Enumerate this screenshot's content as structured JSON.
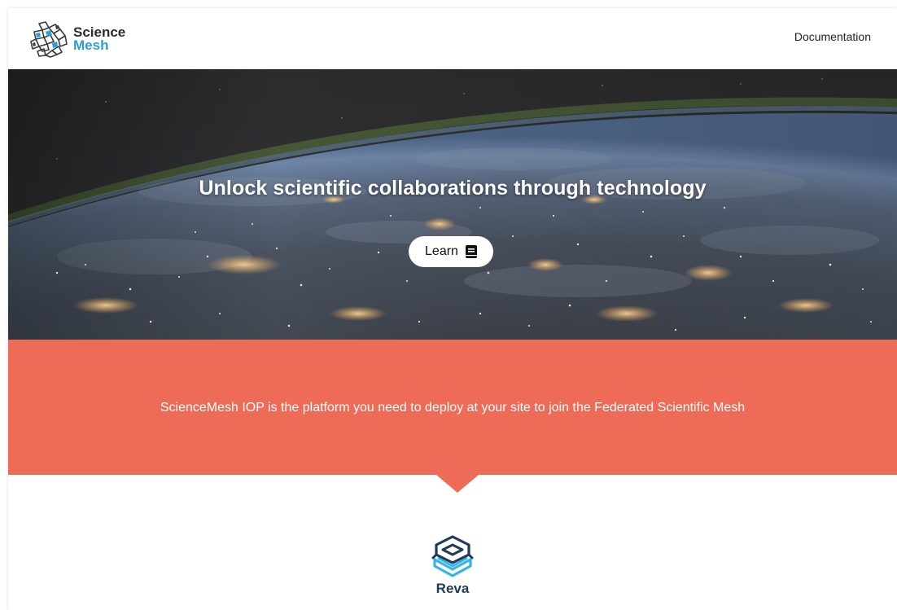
{
  "header": {
    "brand_word1": "Science",
    "brand_word2": "Mesh",
    "nav": [
      {
        "label": "Documentation"
      }
    ]
  },
  "hero": {
    "title": "Unlock scientific collaborations through technology",
    "button_label": "Learn",
    "button_icon": "book-icon"
  },
  "band": {
    "text": "ScienceMesh IOP is the platform you need to deploy at your site to join the Federated Scientific Mesh",
    "color": "#ee6b58"
  },
  "reva": {
    "label": "Reva",
    "icon": "reva-logo-icon"
  },
  "colors": {
    "brand_blue": "#2a9fd6",
    "coral": "#ee6b58",
    "reva_navy": "#1f3b57",
    "reva_cyan": "#35b5e5"
  }
}
